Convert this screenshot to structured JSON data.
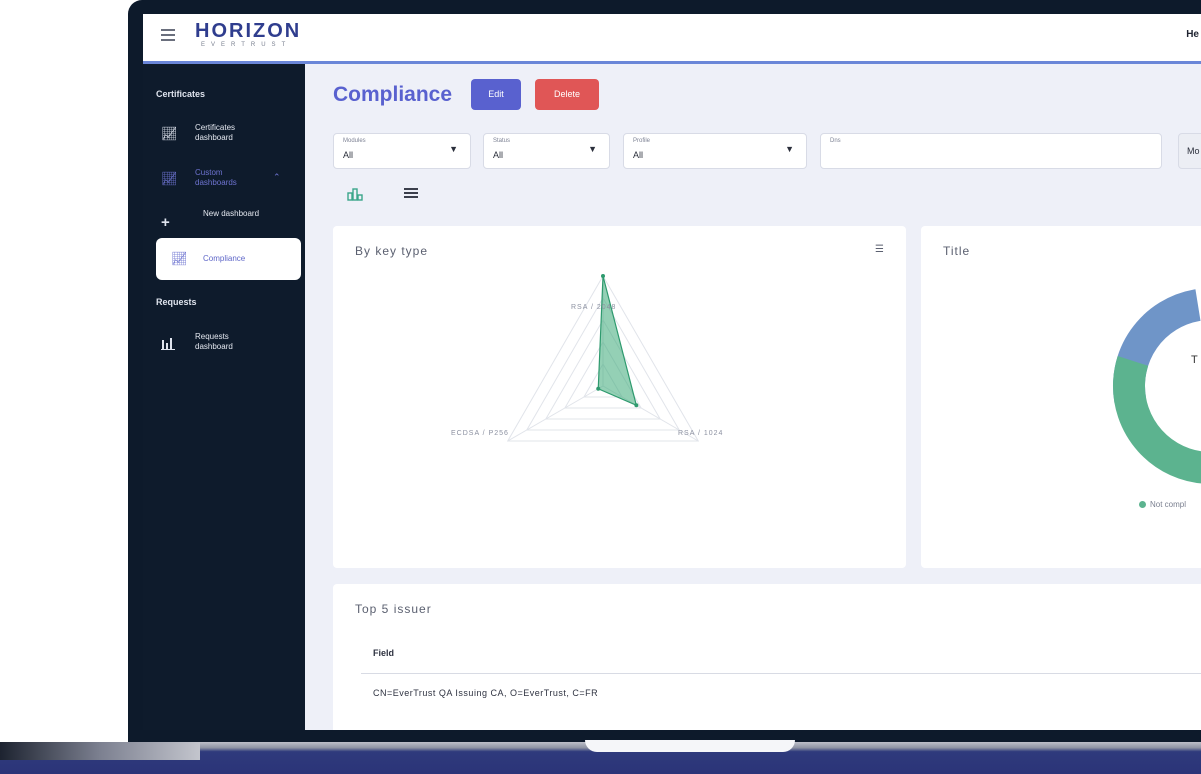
{
  "header": {
    "logo_main": "HORIZON",
    "logo_sub": "EVERTRUST",
    "user_short": "He"
  },
  "sidebar": {
    "certificates_title": "Certificates",
    "items": [
      {
        "label": "Certificates dashboard",
        "icon": "line-chart-icon"
      },
      {
        "label": "Custom dashboards",
        "icon": "line-chart-icon",
        "expanded": true
      },
      {
        "label": "New dashboard",
        "icon": "plus-icon"
      },
      {
        "label": "Compliance",
        "icon": "line-chart-icon",
        "active": true
      }
    ],
    "requests_title": "Requests",
    "requests_items": [
      {
        "label": "Requests dashboard",
        "icon": "bar-chart-icon"
      }
    ]
  },
  "main": {
    "title": "Compliance",
    "edit_label": "Edit",
    "delete_label": "Delete",
    "filters": [
      {
        "label": "Modules",
        "value": "All"
      },
      {
        "label": "Status",
        "value": "All"
      },
      {
        "label": "Profile",
        "value": "All"
      },
      {
        "label": "Dns",
        "value": ""
      }
    ],
    "more_label": "Mo"
  },
  "cards": {
    "key_type": {
      "title": "By key type",
      "axes": [
        "RSA / 2048",
        "RSA / 1024",
        "ECDSA / P256"
      ]
    },
    "donut": {
      "title": "Title",
      "center_text": "T",
      "legend": "Not compl"
    },
    "issuers": {
      "title": "Top 5 issuer",
      "column": "Field",
      "row": "CN=EverTrust QA Issuing CA, O=EverTrust, C=FR"
    }
  },
  "colors": {
    "accent": "#5961cf",
    "danger": "#e05656",
    "sidebar_bg": "#0e1b2c",
    "green": "#5cb38f",
    "blue": "#6f95c8"
  },
  "chart_data": {
    "type": "radar",
    "title": "By key type",
    "categories": [
      "RSA / 2048",
      "RSA / 1024",
      "ECDSA / P256"
    ],
    "values": [
      1.0,
      0.35,
      0.05
    ]
  }
}
